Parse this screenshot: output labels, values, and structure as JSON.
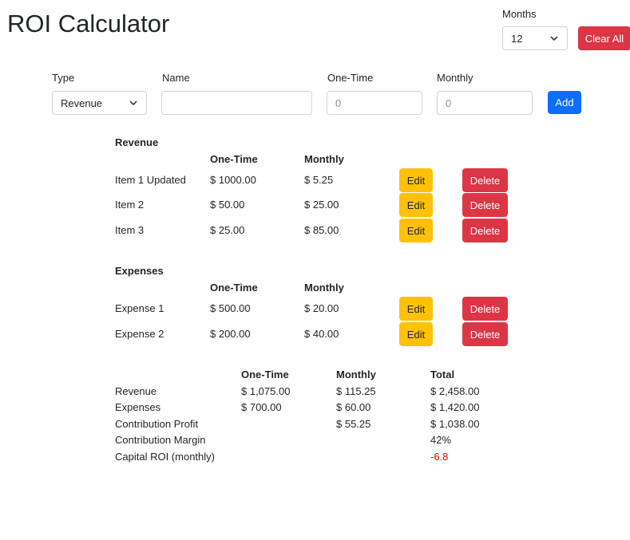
{
  "header": {
    "title": "ROI Calculator",
    "months_label": "Months",
    "months_value": "12",
    "clear_all_label": "Clear All"
  },
  "form": {
    "type_label": "Type",
    "type_value": "Revenue",
    "name_label": "Name",
    "name_value": "",
    "onetime_label": "One-Time",
    "onetime_placeholder": "0",
    "monthly_label": "Monthly",
    "monthly_placeholder": "0",
    "add_label": "Add"
  },
  "revenue": {
    "title": "Revenue",
    "col_onetime": "One-Time",
    "col_monthly": "Monthly",
    "rows": [
      {
        "name": "Item 1 Updated",
        "onetime": "$ 1000.00",
        "monthly": "$ 5.25",
        "edit": "Edit",
        "delete": "Delete"
      },
      {
        "name": "Item 2",
        "onetime": "$ 50.00",
        "monthly": "$ 25.00",
        "edit": "Edit",
        "delete": "Delete"
      },
      {
        "name": "Item 3",
        "onetime": "$ 25.00",
        "monthly": "$ 85.00",
        "edit": "Edit",
        "delete": "Delete"
      }
    ]
  },
  "expenses": {
    "title": "Expenses",
    "col_onetime": "One-Time",
    "col_monthly": "Monthly",
    "rows": [
      {
        "name": "Expense 1",
        "onetime": "$ 500.00",
        "monthly": "$ 20.00",
        "edit": "Edit",
        "delete": "Delete"
      },
      {
        "name": "Expense 2",
        "onetime": "$ 200.00",
        "monthly": "$ 40.00",
        "edit": "Edit",
        "delete": "Delete"
      }
    ]
  },
  "summary": {
    "col_onetime": "One-Time",
    "col_monthly": "Monthly",
    "col_total": "Total",
    "rows": [
      {
        "label": "Revenue",
        "onetime": "$ 1,075.00",
        "monthly": "$ 115.25",
        "total": "$ 2,458.00"
      },
      {
        "label": "Expenses",
        "onetime": "$ 700.00",
        "monthly": "$ 60.00",
        "total": "$ 1,420.00"
      },
      {
        "label": "Contribution Profit",
        "onetime": "",
        "monthly": "$ 55.25",
        "total": "$ 1,038.00"
      },
      {
        "label": "Contribution Margin",
        "onetime": "",
        "monthly": "",
        "total": "42%"
      },
      {
        "label": "Capital ROI (monthly)",
        "onetime": "",
        "monthly": "",
        "total": "-6.8"
      }
    ]
  },
  "colors": {
    "danger": "#dc3545",
    "primary": "#0d6efd",
    "warning": "#ffc107",
    "negative": "#ff0000"
  }
}
